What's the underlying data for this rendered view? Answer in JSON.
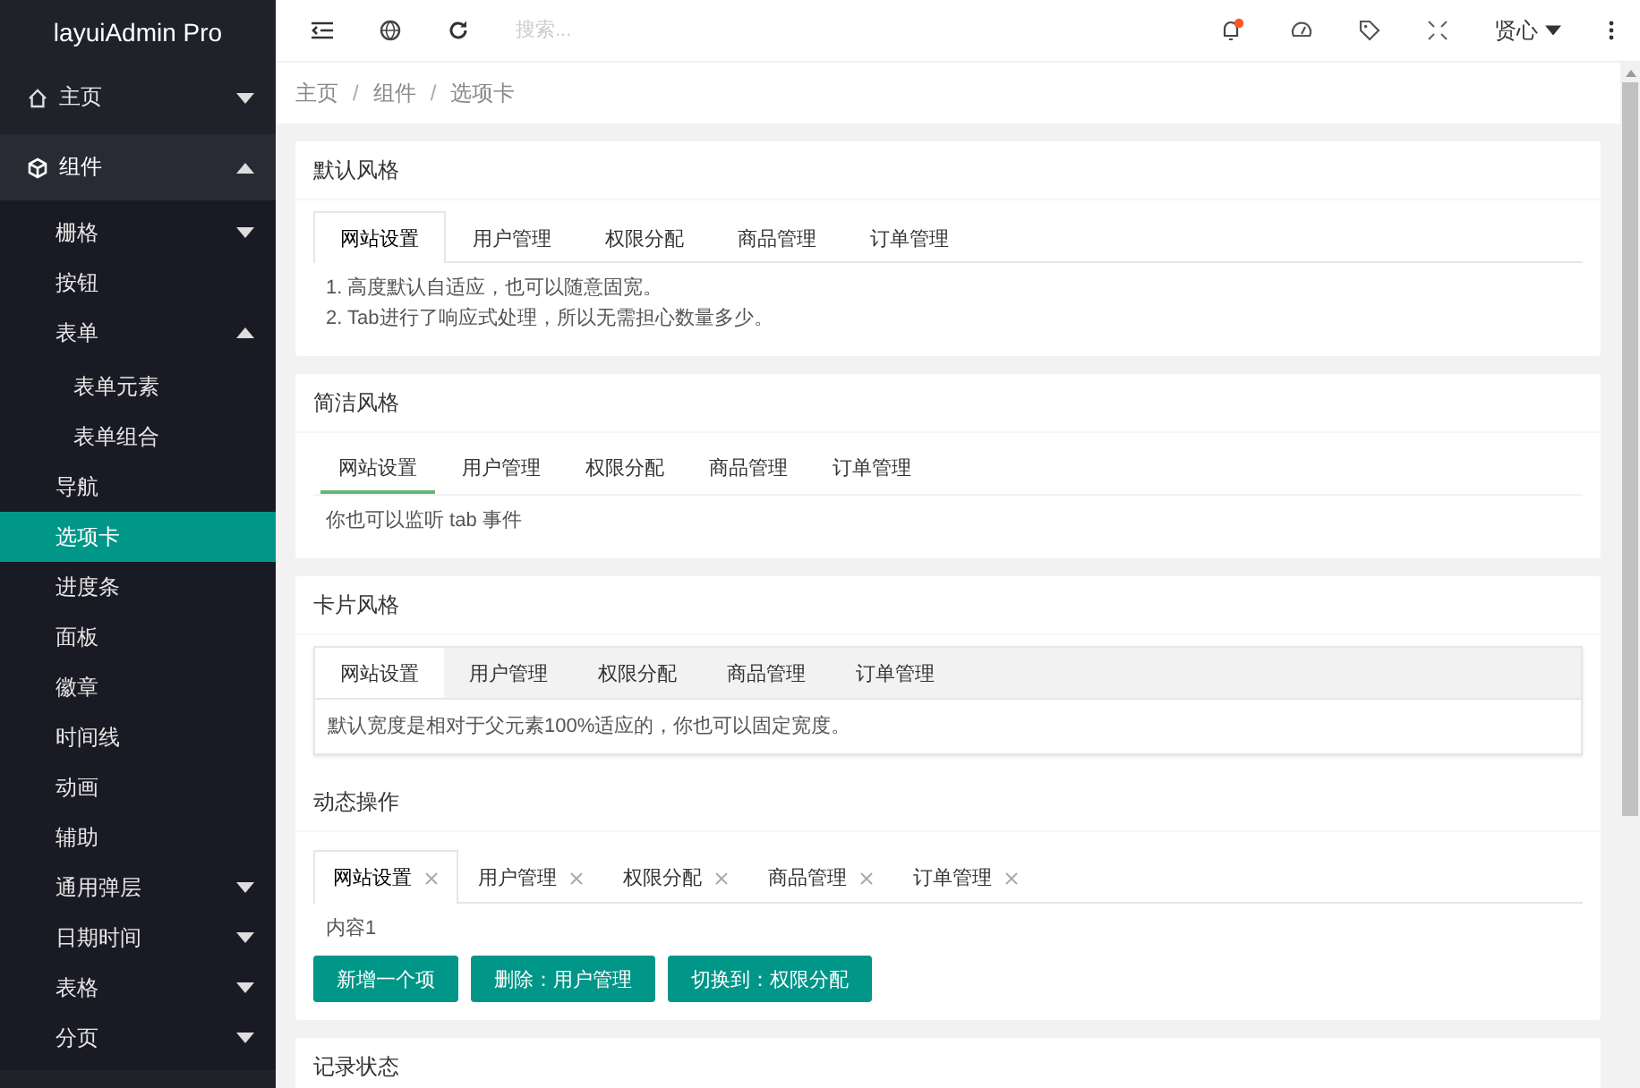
{
  "header": {
    "logo": "layuiAdmin Pro",
    "search": {
      "placeholder": "搜索..."
    },
    "notification_dot": true,
    "user": "贤心"
  },
  "breadcrumb": {
    "separator": "/",
    "items": [
      "主页",
      "组件",
      "选项卡"
    ]
  },
  "sidebar": {
    "items": [
      {
        "label": "主页",
        "kind": "group",
        "expanded": false,
        "selected": false
      },
      {
        "label": "组件",
        "kind": "group",
        "expanded": true,
        "selected": false,
        "children": [
          {
            "label": "栅格",
            "kind": "group",
            "expanded": false,
            "selected": false
          },
          {
            "label": "按钮",
            "kind": "link",
            "selected": false
          },
          {
            "label": "表单",
            "kind": "group",
            "expanded": true,
            "selected": false,
            "children": [
              {
                "label": "表单元素",
                "kind": "link",
                "selected": false
              },
              {
                "label": "表单组合",
                "kind": "link",
                "selected": false
              }
            ]
          },
          {
            "label": "导航",
            "kind": "link",
            "selected": false
          },
          {
            "label": "选项卡",
            "kind": "link",
            "selected": true
          },
          {
            "label": "进度条",
            "kind": "link",
            "selected": false
          },
          {
            "label": "面板",
            "kind": "link",
            "selected": false
          },
          {
            "label": "徽章",
            "kind": "link",
            "selected": false
          },
          {
            "label": "时间线",
            "kind": "link",
            "selected": false
          },
          {
            "label": "动画",
            "kind": "link",
            "selected": false
          },
          {
            "label": "辅助",
            "kind": "link",
            "selected": false
          },
          {
            "label": "通用弹层",
            "kind": "group",
            "expanded": false,
            "selected": false
          },
          {
            "label": "日期时间",
            "kind": "group",
            "expanded": false,
            "selected": false
          },
          {
            "label": "表格",
            "kind": "group",
            "expanded": false,
            "selected": false
          },
          {
            "label": "分页",
            "kind": "group",
            "expanded": false,
            "selected": false
          }
        ]
      }
    ]
  },
  "cards": [
    {
      "panels": [
        {
          "heading": "默认风格",
          "kind": "default",
          "tabs": [
            {
              "label": "网站设置",
              "selected": true
            },
            {
              "label": "用户管理",
              "selected": false
            },
            {
              "label": "权限分配",
              "selected": false
            },
            {
              "label": "商品管理",
              "selected": false
            },
            {
              "label": "订单管理",
              "selected": false
            }
          ],
          "content": [
            "1. 高度默认自适应，也可以随意固宽。",
            "2. Tab进行了响应式处理，所以无需担心数量多少。"
          ]
        }
      ]
    },
    {
      "panels": [
        {
          "heading": "简洁风格",
          "kind": "brief",
          "tabs": [
            {
              "label": "网站设置",
              "selected": true
            },
            {
              "label": "用户管理",
              "selected": false
            },
            {
              "label": "权限分配",
              "selected": false
            },
            {
              "label": "商品管理",
              "selected": false
            },
            {
              "label": "订单管理",
              "selected": false
            }
          ],
          "content": [
            "你也可以监听 tab 事件"
          ]
        }
      ]
    },
    {
      "panels": [
        {
          "heading": "卡片风格",
          "kind": "card",
          "tabs": [
            {
              "label": "网站设置",
              "selected": true
            },
            {
              "label": "用户管理",
              "selected": false
            },
            {
              "label": "权限分配",
              "selected": false
            },
            {
              "label": "商品管理",
              "selected": false
            },
            {
              "label": "订单管理",
              "selected": false
            }
          ],
          "content": [
            "默认宽度是相对于父元素100%适应的，你也可以固定宽度。"
          ]
        },
        {
          "heading": "动态操作",
          "kind": "closable",
          "tabs": [
            {
              "label": "网站设置",
              "selected": true
            },
            {
              "label": "用户管理",
              "selected": false
            },
            {
              "label": "权限分配",
              "selected": false
            },
            {
              "label": "商品管理",
              "selected": false
            },
            {
              "label": "订单管理",
              "selected": false
            }
          ],
          "content": [
            "内容1"
          ],
          "buttons": [
            "新增一个项",
            "删除：用户管理",
            "切换到：权限分配"
          ]
        }
      ]
    },
    {
      "panels": [
        {
          "heading": "记录状态"
        }
      ]
    }
  ]
}
